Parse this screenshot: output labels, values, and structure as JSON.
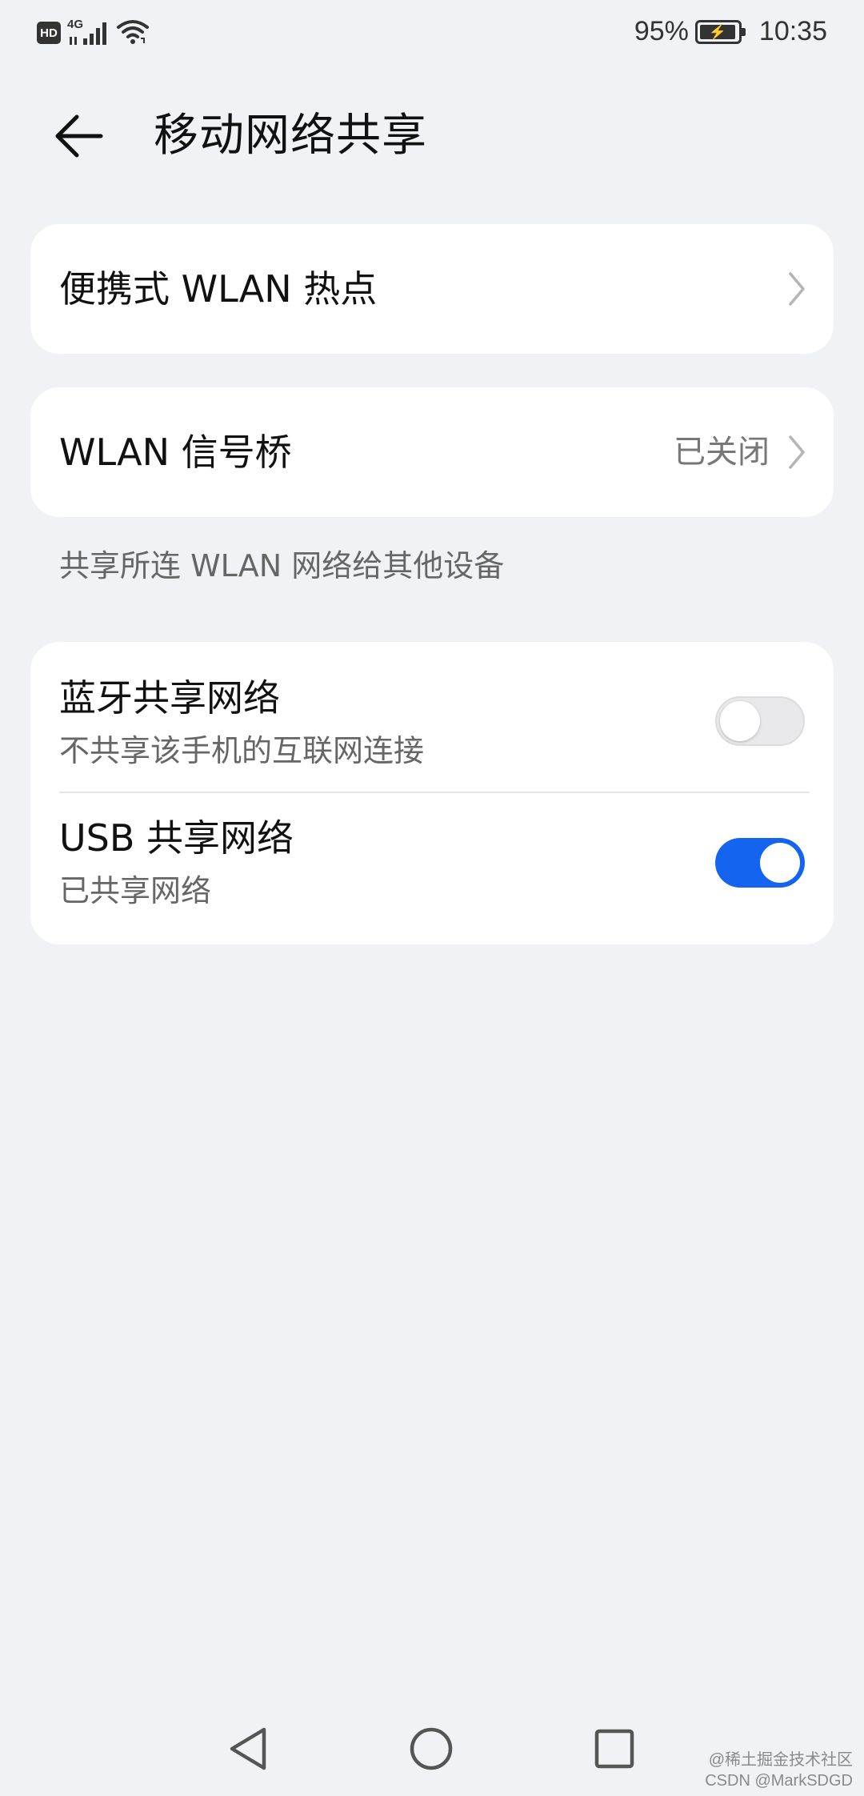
{
  "status_bar": {
    "hd": "HD",
    "network": "4G",
    "battery_percent": "95%",
    "time": "10:35",
    "icons": [
      "hd-badge",
      "signal-icon",
      "wifi-icon",
      "battery-charging-icon"
    ]
  },
  "header": {
    "title": "移动网络共享",
    "back_icon": "arrow-left-icon"
  },
  "hotspot": {
    "label": "便携式 WLAN 热点"
  },
  "wlan_bridge": {
    "label": "WLAN 信号桥",
    "value": "已关闭",
    "hint": "共享所连 WLAN 网络给其他设备"
  },
  "bluetooth_tethering": {
    "title": "蓝牙共享网络",
    "subtitle": "不共享该手机的互联网连接",
    "enabled": false
  },
  "usb_tethering": {
    "title": "USB 共享网络",
    "subtitle": "已共享网络",
    "enabled": true
  },
  "colors": {
    "accent": "#1464f0",
    "background": "#f1f2f5",
    "card": "#ffffff"
  },
  "watermark": {
    "line1": "@稀土掘金技术社区",
    "line2": "CSDN @MarkSDGD"
  }
}
